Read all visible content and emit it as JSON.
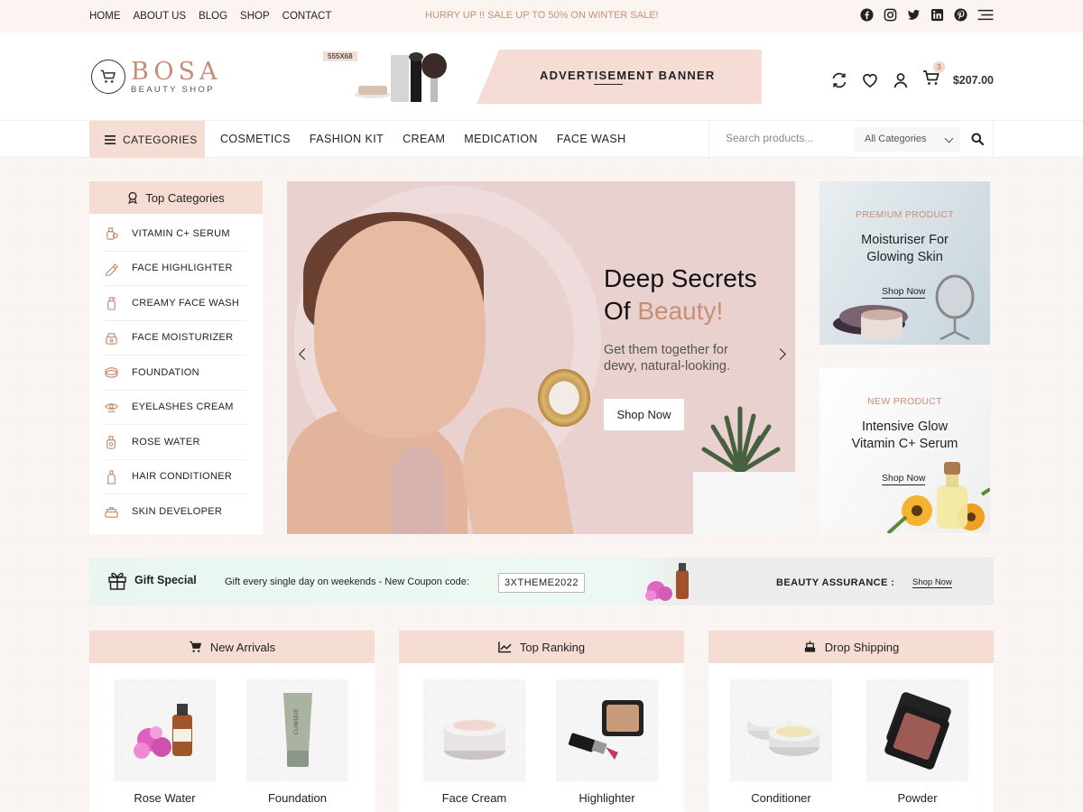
{
  "topbar": {
    "nav": [
      "HOME",
      "ABOUT US",
      "BLOG",
      "SHOP",
      "CONTACT"
    ],
    "promo": "HURRY UP !! SALE UP TO 50% ON WINTER SALE!",
    "social_icons": [
      "facebook-icon",
      "instagram-icon",
      "twitter-icon",
      "linkedin-icon",
      "pinterest-icon",
      "menu-icon"
    ]
  },
  "header": {
    "brand": "BOSA",
    "tagline": "BEAUTY SHOP",
    "ad_size": "555X68",
    "ad_text": "ADVERTISEMENT BANNER",
    "cart_count": "3",
    "cart_total": "$207.00"
  },
  "nav": {
    "categories_label": "CATEGORIES",
    "items": [
      "COSMETICS",
      "FASHION KIT",
      "CREAM",
      "MEDICATION",
      "FACE WASH"
    ],
    "search_placeholder": "Search products...",
    "category_select": "All Categories"
  },
  "sidebar": {
    "title": "Top Categories",
    "items": [
      "VITAMIN C+ SERUM",
      "FACE HIGHLIGHTER",
      "CREAMY FACE WASH",
      "FACE MOISTURIZER",
      "FOUNDATION",
      "EYELASHES CREAM",
      "ROSE WATER",
      "HAIR CONDITIONER",
      "SKIN DEVELOPER"
    ]
  },
  "hero": {
    "title_line1": "Deep Secrets",
    "title_of": "Of ",
    "title_accent": "Beauty!",
    "subtitle": "Get them together for dewy, natural-looking.",
    "button": "Shop Now"
  },
  "promo_cards": [
    {
      "label": "PREMIUM PRODUCT",
      "title_line1": "Moisturiser For",
      "title_line2": "Glowing Skin",
      "link": "Shop Now"
    },
    {
      "label": "NEW PRODUCT",
      "title_line1": "Intensive Glow",
      "title_line2": "Vitamin C+ Serum",
      "link": "Shop Now"
    }
  ],
  "gift": {
    "title": "Gift Special",
    "text": "Gift every single day on weekends -  New Coupon code:",
    "code": "3XTHEME2022",
    "assurance": "BEAUTY ASSURANCE :",
    "link": "Shop Now"
  },
  "sections": [
    {
      "title": "New Arrivals",
      "products": [
        "Rose Water",
        "Foundation"
      ]
    },
    {
      "title": "Top Ranking",
      "products": [
        "Face Cream",
        "Highlighter"
      ]
    },
    {
      "title": "Drop Shipping",
      "products": [
        "Conditioner",
        "Powder"
      ]
    }
  ],
  "colors": {
    "accent": "#c98f75",
    "pink_bg": "#f6ddd4",
    "mint_bg": "#e9f6ef"
  }
}
